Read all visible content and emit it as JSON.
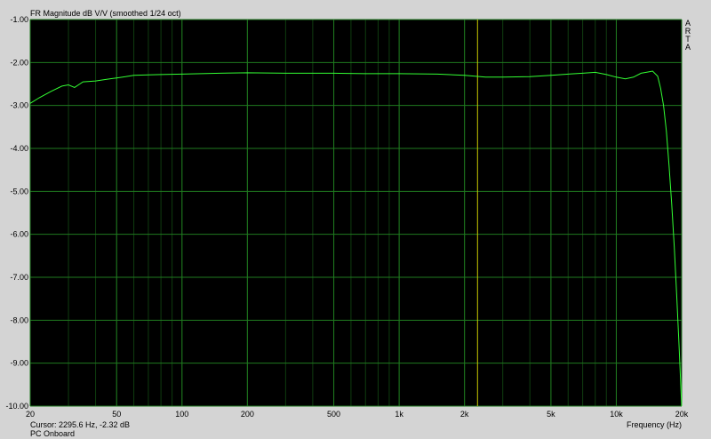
{
  "title": "FR Magnitude dB V/V (smoothed 1/24 oct)",
  "cursor_readout": "Cursor: 2295.6 Hz, -2.32 dB",
  "device_name": "PC Onboard",
  "brand_letters": [
    "A",
    "R",
    "T",
    "A"
  ],
  "colors": {
    "background": "#d4d4d4",
    "plot_background": "#000000",
    "grid_major": "#1f7a1f",
    "grid_minor": "#0f3d0f",
    "trace": "#33ff33",
    "cursor_line": "#c8c800"
  },
  "chart_data": {
    "type": "line",
    "title": "FR Magnitude dB V/V (smoothed 1/24 oct)",
    "xlabel": "Frequency (Hz)",
    "ylabel": "",
    "x_scale": "log",
    "xlim": [
      20,
      20000
    ],
    "ylim": [
      -10,
      -1
    ],
    "grid": true,
    "x_ticks": [
      {
        "value": 20,
        "label": "20"
      },
      {
        "value": 50,
        "label": "50"
      },
      {
        "value": 100,
        "label": "100"
      },
      {
        "value": 200,
        "label": "200"
      },
      {
        "value": 500,
        "label": "500"
      },
      {
        "value": 1000,
        "label": "1k"
      },
      {
        "value": 2000,
        "label": "2k"
      },
      {
        "value": 5000,
        "label": "5k"
      },
      {
        "value": 10000,
        "label": "10k"
      },
      {
        "value": 20000,
        "label": "20k"
      }
    ],
    "y_ticks": [
      {
        "value": -1,
        "label": "-1.00"
      },
      {
        "value": -2,
        "label": "-2.00"
      },
      {
        "value": -3,
        "label": "-3.00"
      },
      {
        "value": -4,
        "label": "-4.00"
      },
      {
        "value": -5,
        "label": "-5.00"
      },
      {
        "value": -6,
        "label": "-6.00"
      },
      {
        "value": -7,
        "label": "-7.00"
      },
      {
        "value": -8,
        "label": "-8.00"
      },
      {
        "value": -9,
        "label": "-9.00"
      },
      {
        "value": -10,
        "label": "-10.00"
      }
    ],
    "cursor": {
      "x": 2295.6,
      "y": -2.32
    },
    "series": [
      {
        "x": [
          20,
          22,
          25,
          28,
          30,
          32,
          35,
          40,
          45,
          50,
          55,
          60,
          70,
          80,
          100,
          150,
          200,
          300,
          500,
          700,
          1000,
          1500,
          2000,
          2500,
          3000,
          4000,
          5000,
          6000,
          7000,
          8000,
          9000,
          10000,
          11000,
          12000,
          13000,
          14000,
          14700,
          15500,
          16000,
          16500,
          17000,
          17500,
          18000,
          18500,
          19000,
          19500,
          20000
        ],
        "y": [
          -2.95,
          -2.82,
          -2.67,
          -2.55,
          -2.52,
          -2.58,
          -2.45,
          -2.43,
          -2.39,
          -2.36,
          -2.33,
          -2.3,
          -2.29,
          -2.28,
          -2.27,
          -2.25,
          -2.24,
          -2.25,
          -2.25,
          -2.26,
          -2.26,
          -2.27,
          -2.3,
          -2.34,
          -2.34,
          -2.33,
          -2.3,
          -2.27,
          -2.25,
          -2.23,
          -2.28,
          -2.34,
          -2.38,
          -2.34,
          -2.25,
          -2.22,
          -2.2,
          -2.32,
          -2.6,
          -3.0,
          -3.6,
          -4.4,
          -5.3,
          -6.3,
          -7.5,
          -8.7,
          -10.0
        ]
      }
    ]
  }
}
